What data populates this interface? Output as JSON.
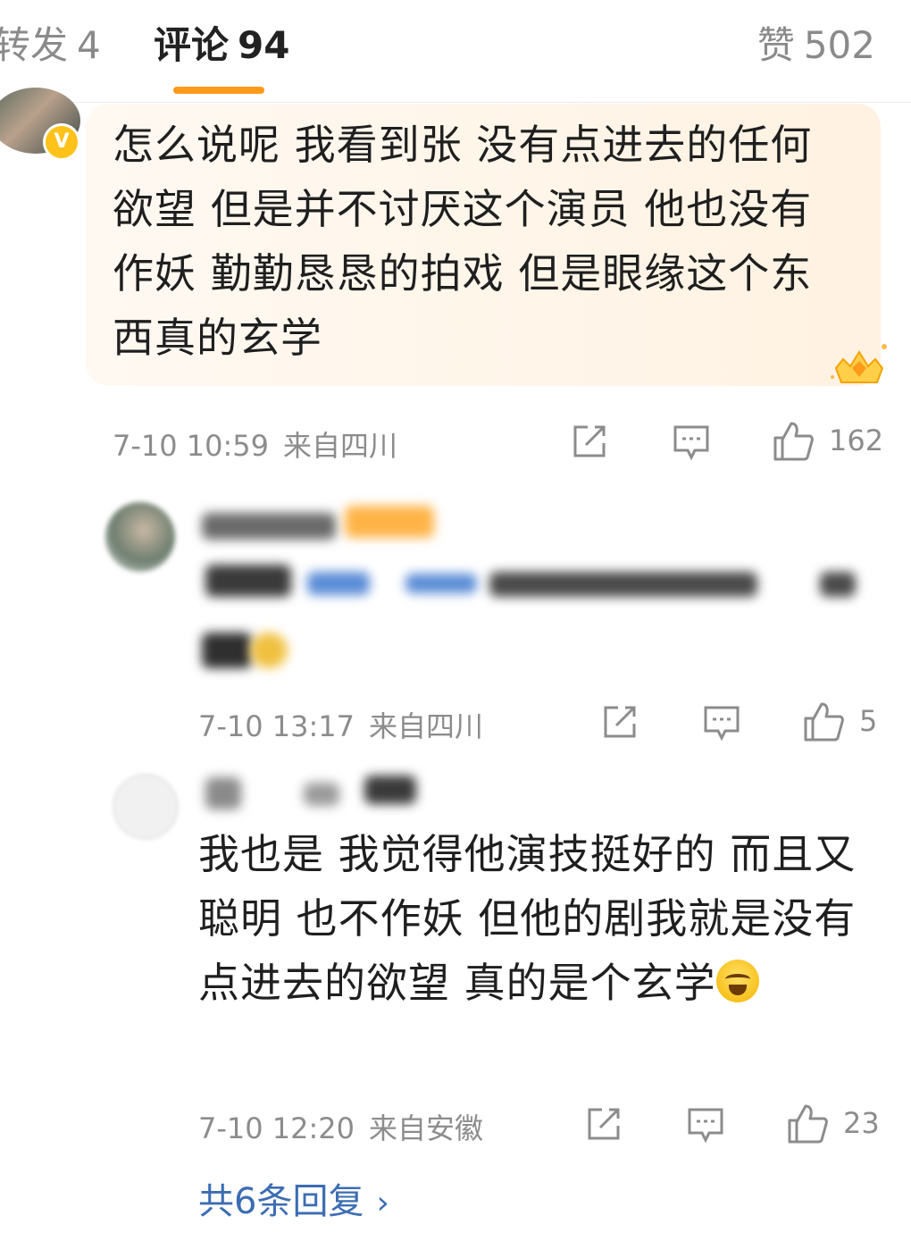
{
  "tabs": {
    "repost_label": "转发",
    "repost_count": "4",
    "comment_label": "评论",
    "comment_count": "94",
    "like_label": "赞",
    "like_count": "502"
  },
  "comments": [
    {
      "text": "怎么说呢  我看到张 没有点进去的任何欲望  但是并不讨厌这个演员  他也没有作妖 勤勤恳恳的拍戏  但是眼缘这个东西真的玄学",
      "time": "7-10 10:59",
      "location": "来自四川",
      "likes": "162",
      "verified_badge": "V"
    },
    {
      "time": "7-10 13:17",
      "location": "来自四川",
      "likes": "5"
    },
    {
      "text": "我也是  我觉得他演技挺好的  而且又聪明 也不作妖  但他的剧我就是没有点进去的欲望  真的是个玄学",
      "time": "7-10 12:20",
      "location": "来自安徽",
      "likes": "23"
    }
  ],
  "more_replies": "共6条回复",
  "icons": [
    "share-icon",
    "comment-icon",
    "thumbs-up-icon",
    "chevron-right-icon",
    "crown-badge-icon",
    "laugh-cry-emoji"
  ],
  "colors": {
    "accent": "#ff9a1a",
    "link": "#3c6db3",
    "meta": "#8c8c8c"
  }
}
